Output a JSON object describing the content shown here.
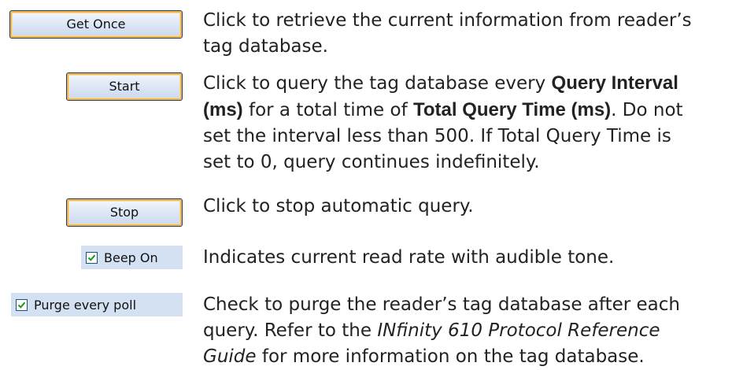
{
  "items": [
    {
      "control": "Get Once",
      "desc_lines": [
        "Click to retrieve the current information from reader’s",
        "tag database."
      ]
    },
    {
      "control": "Start",
      "desc_parts": {
        "p1": "Click to query the tag database every ",
        "b1": "Query Interval",
        "b1b": "(ms)",
        "p2": " for a total time of ",
        "b2": "Total Query Time (ms)",
        "p3": ". Do not",
        "line3": "set the interval less than 500. If Total Query Time is",
        "line4": "set to 0, query continues indefinitely."
      }
    },
    {
      "control": "Stop",
      "desc_lines": [
        "Click to stop automatic query."
      ]
    },
    {
      "control": "Beep On",
      "checked": true,
      "desc_lines": [
        "Indicates current read rate with audible tone."
      ]
    },
    {
      "control": "Purge every poll",
      "checked": true,
      "desc_parts": {
        "line1": "Check to purge the reader’s tag database after each",
        "p1": "query. Refer to the ",
        "i1": "INfinity 610 Protocol Reference",
        "i2": "Guide",
        "p2": " for more information on the tag database."
      }
    }
  ]
}
